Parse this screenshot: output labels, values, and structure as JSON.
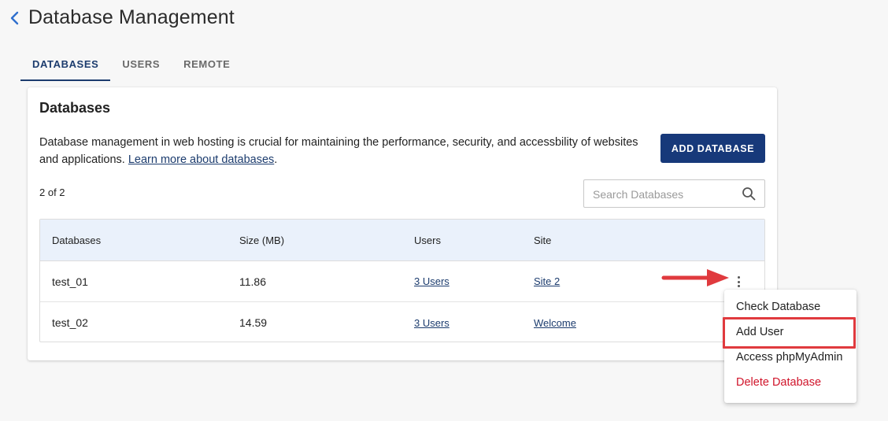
{
  "header": {
    "title": "Database Management",
    "back_icon": "chevron-left-icon"
  },
  "tabs": [
    {
      "label": "DATABASES",
      "active": true
    },
    {
      "label": "USERS",
      "active": false
    },
    {
      "label": "REMOTE",
      "active": false
    }
  ],
  "card": {
    "title": "Databases",
    "description": "Database management in web hosting is crucial for maintaining the performance, security, and accessbility of websites and applications.",
    "learn_more_link": "Learn more about databases",
    "period": ".",
    "add_button_label": "ADD DATABASE",
    "count_text": "2 of 2",
    "search": {
      "placeholder": "Search Databases",
      "value": "",
      "icon": "search-icon"
    }
  },
  "table": {
    "columns": [
      "Databases",
      "Size (MB)",
      "Users",
      "Site"
    ],
    "rows": [
      {
        "database": "test_01",
        "size": "11.86",
        "users": "3 Users",
        "site": "Site 2"
      },
      {
        "database": "test_02",
        "size": "14.59",
        "users": "3 Users",
        "site": "Welcome"
      }
    ]
  },
  "context_menu": {
    "items": [
      {
        "label": "Check Database"
      },
      {
        "label": "Add User"
      },
      {
        "label": "Access phpMyAdmin"
      },
      {
        "label": "Delete Database"
      }
    ]
  },
  "colors": {
    "accent": "#17397a",
    "danger": "#d0142a",
    "annotation": "#e03a3e",
    "table_header_bg": "#eaf1fb"
  }
}
